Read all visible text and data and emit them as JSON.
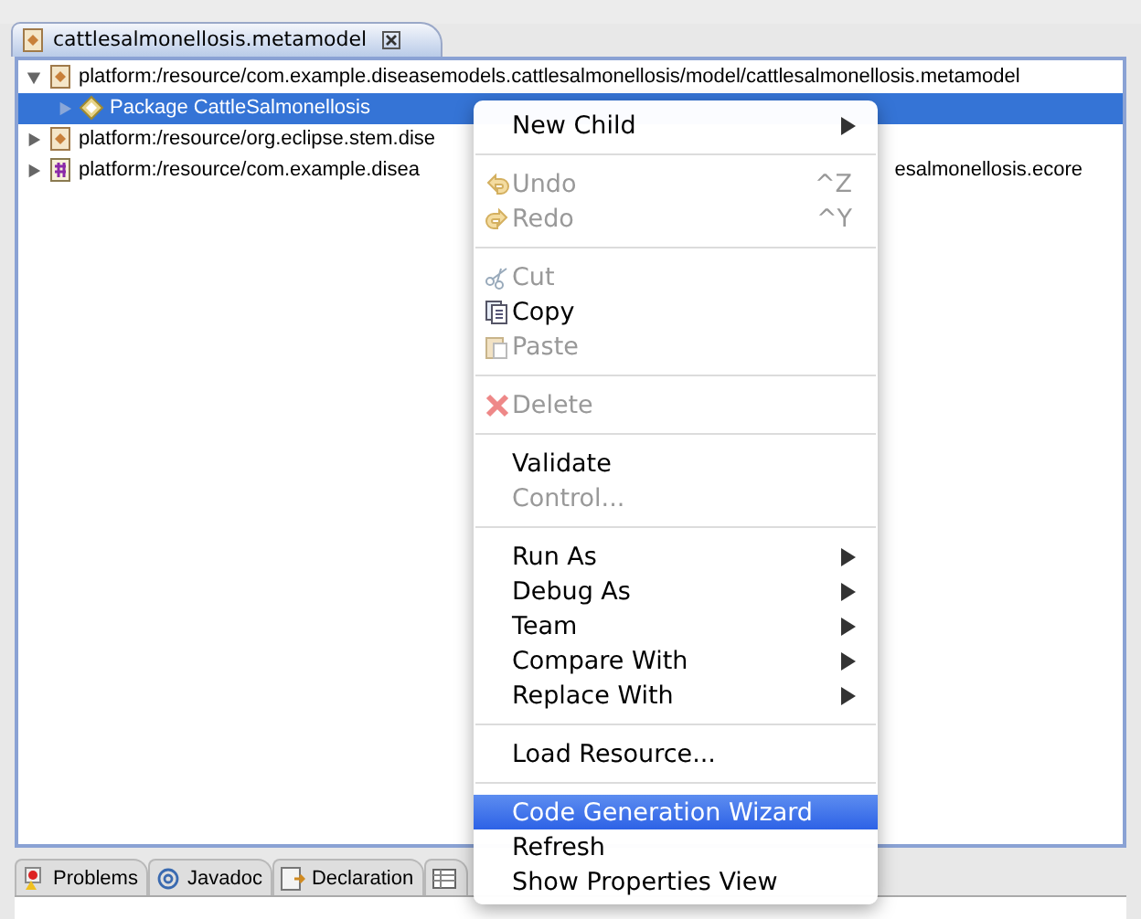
{
  "editor_tab": {
    "title": "cattlesalmonellosis.metamodel",
    "selected": true
  },
  "tree": [
    {
      "label": "platform:/resource/com.example.diseasemodels.cattlesalmonellosis/model/cattlesalmonellosis.metamodel",
      "expanded": true,
      "selected": false,
      "children": [
        {
          "label": "Package CattleSalmonellosis",
          "expanded": false,
          "selected": true
        }
      ]
    },
    {
      "label": "platform:/resource/org.eclipse.stem.dise",
      "expanded": false,
      "selected": false
    },
    {
      "label": "platform:/resource/com.example.disea",
      "label_after_menu": "esalmonellosis.ecore",
      "expanded": false,
      "selected": false
    }
  ],
  "context_menu": [
    {
      "kind": "item",
      "label": "New Child",
      "submenu": true,
      "disabled": false,
      "selected": false
    },
    {
      "kind": "separator"
    },
    {
      "kind": "item",
      "label": "Undo",
      "shortcut": "^Z",
      "disabled": true,
      "selected": false
    },
    {
      "kind": "item",
      "label": "Redo",
      "shortcut": "^Y",
      "disabled": true,
      "selected": false
    },
    {
      "kind": "separator"
    },
    {
      "kind": "item",
      "label": "Cut",
      "disabled": true,
      "selected": false
    },
    {
      "kind": "item",
      "label": "Copy",
      "disabled": false,
      "selected": false
    },
    {
      "kind": "item",
      "label": "Paste",
      "disabled": true,
      "selected": false
    },
    {
      "kind": "separator"
    },
    {
      "kind": "item",
      "label": "Delete",
      "disabled": true,
      "selected": false
    },
    {
      "kind": "separator"
    },
    {
      "kind": "item",
      "label": "Validate",
      "disabled": false,
      "selected": false
    },
    {
      "kind": "item",
      "label": "Control...",
      "disabled": true,
      "selected": false
    },
    {
      "kind": "separator"
    },
    {
      "kind": "item",
      "label": "Run As",
      "submenu": true,
      "disabled": false,
      "selected": false
    },
    {
      "kind": "item",
      "label": "Debug As",
      "submenu": true,
      "disabled": false,
      "selected": false
    },
    {
      "kind": "item",
      "label": "Team",
      "submenu": true,
      "disabled": false,
      "selected": false
    },
    {
      "kind": "item",
      "label": "Compare With",
      "submenu": true,
      "disabled": false,
      "selected": false
    },
    {
      "kind": "item",
      "label": "Replace With",
      "submenu": true,
      "disabled": false,
      "selected": false
    },
    {
      "kind": "separator"
    },
    {
      "kind": "item",
      "label": "Load Resource...",
      "disabled": false,
      "selected": false
    },
    {
      "kind": "separator"
    },
    {
      "kind": "item",
      "label": "Code Generation Wizard",
      "disabled": false,
      "selected": true
    },
    {
      "kind": "item",
      "label": "Refresh",
      "disabled": false,
      "selected": false
    },
    {
      "kind": "item",
      "label": "Show Properties View",
      "disabled": false,
      "selected": false
    }
  ],
  "bottom_tabs": [
    {
      "label": "Problems",
      "selected": false
    },
    {
      "label": "Javadoc",
      "selected": false
    },
    {
      "label": "Declaration",
      "selected": false
    }
  ]
}
